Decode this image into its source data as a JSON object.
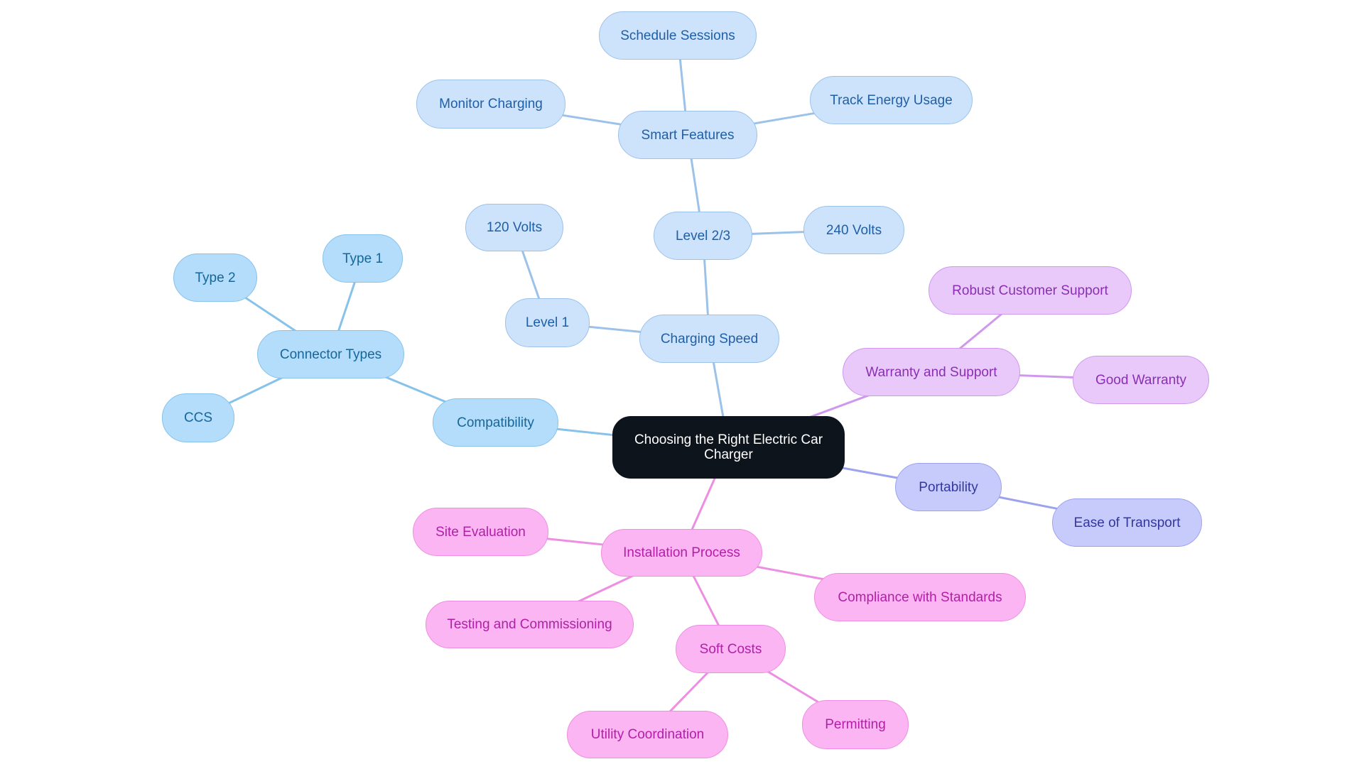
{
  "diagram": {
    "type": "mindmap",
    "root": {
      "id": "root",
      "label": "Choosing the Right Electric Car Charger"
    },
    "branch_colors": {
      "compatibility": {
        "fill": "#b3ddfa",
        "stroke": "#86c2ea",
        "text": "#17669a",
        "edge": "#86c2ea"
      },
      "charging": {
        "fill": "#cde3fb",
        "stroke": "#9cc2ea",
        "text": "#1f5fa8",
        "edge": "#9cc2ea"
      },
      "warranty": {
        "fill": "#e9c9fa",
        "stroke": "#cf98ec",
        "text": "#8a2fb4",
        "edge": "#cf98ec"
      },
      "portability": {
        "fill": "#c7cbfc",
        "stroke": "#9ca3ee",
        "text": "#3337a0",
        "edge": "#9ca3ee"
      },
      "installation": {
        "fill": "#fbb5f3",
        "stroke": "#ee8ee2",
        "text": "#b21fa6",
        "edge": "#ee8ee2"
      }
    },
    "nodes": [
      {
        "id": "compatibility",
        "label": "Compatibility",
        "parent": "root"
      },
      {
        "id": "connector_types",
        "label": "Connector Types",
        "parent": "compatibility"
      },
      {
        "id": "type2",
        "label": "Type 2",
        "parent": "connector_types"
      },
      {
        "id": "type1",
        "label": "Type 1",
        "parent": "connector_types"
      },
      {
        "id": "ccs",
        "label": "CCS",
        "parent": "connector_types"
      },
      {
        "id": "charging_speed",
        "label": "Charging Speed",
        "parent": "root"
      },
      {
        "id": "level1",
        "label": "Level 1",
        "parent": "charging_speed"
      },
      {
        "id": "v120",
        "label": "120 Volts",
        "parent": "level1"
      },
      {
        "id": "level23",
        "label": "Level 2/3",
        "parent": "charging_speed"
      },
      {
        "id": "v240",
        "label": "240 Volts",
        "parent": "level23"
      },
      {
        "id": "smart_features",
        "label": "Smart Features",
        "parent": "level23"
      },
      {
        "id": "monitor",
        "label": "Monitor Charging",
        "parent": "smart_features"
      },
      {
        "id": "schedule",
        "label": "Schedule Sessions",
        "parent": "smart_features"
      },
      {
        "id": "track",
        "label": "Track Energy Usage",
        "parent": "smart_features"
      },
      {
        "id": "warranty_support",
        "label": "Warranty and Support",
        "parent": "root"
      },
      {
        "id": "robust",
        "label": "Robust Customer Support",
        "parent": "warranty_support"
      },
      {
        "id": "good_warranty",
        "label": "Good Warranty",
        "parent": "warranty_support"
      },
      {
        "id": "portability",
        "label": "Portability",
        "parent": "root"
      },
      {
        "id": "ease",
        "label": "Ease of Transport",
        "parent": "portability"
      },
      {
        "id": "installation",
        "label": "Installation Process",
        "parent": "root"
      },
      {
        "id": "site_eval",
        "label": "Site Evaluation",
        "parent": "installation"
      },
      {
        "id": "testing",
        "label": "Testing and Commissioning",
        "parent": "installation"
      },
      {
        "id": "compliance",
        "label": "Compliance with Standards",
        "parent": "installation"
      },
      {
        "id": "soft_costs",
        "label": "Soft Costs",
        "parent": "installation"
      },
      {
        "id": "utility",
        "label": "Utility Coordination",
        "parent": "soft_costs"
      },
      {
        "id": "permitting",
        "label": "Permitting",
        "parent": "soft_costs"
      }
    ]
  }
}
